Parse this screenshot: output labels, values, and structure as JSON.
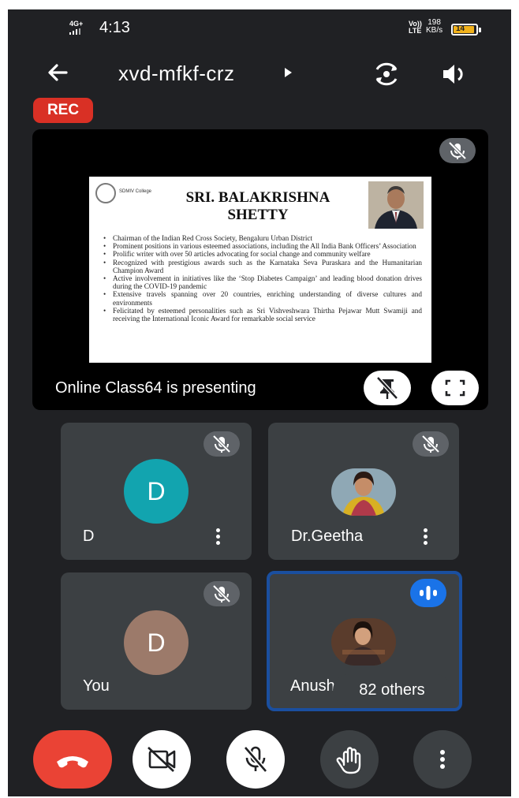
{
  "status_bar": {
    "network_left": "4G+",
    "time": "4:13",
    "network_right_1": "Vo))",
    "network_right_2": "LTE",
    "speed_value": "198",
    "speed_unit": "KB/s",
    "battery_level": "14"
  },
  "top_bar": {
    "meeting_code": "xvd-mfkf-crz"
  },
  "rec_label": "REC",
  "presentation": {
    "slide": {
      "logo_text": "SDMIV College",
      "title_line1": "SRI. BALAKRISHNA",
      "title_line2": "SHETTY",
      "bullets": [
        "Chairman of the Indian Red Cross Society, Bengaluru Urban District",
        "Prominent positions in various esteemed associations, including the All India Bank Officers’ Association",
        "Prolific writer with over 50 articles advocating for social change and community welfare",
        "Recognized with prestigious awards such as the Karnataka Seva Puraskara and the Humanitarian Champion Award",
        "Active involvement in initiatives like the ‘Stop Diabetes Campaign’ and leading blood donation drives during the COVID-19 pandemic",
        "Extensive travels spanning over 20 countries, enriching understanding of diverse cultures and environments",
        "Felicitated by esteemed personalities such as Sri Vishveshwara Thirtha Pejawar Mutt Swamiji and receiving the International Iconic Award for remarkable social service"
      ]
    },
    "presenting_text": "Online Class64 is presenting"
  },
  "participants": [
    {
      "name": "D",
      "avatar_letter": "D",
      "avatar_color": "#12a4af"
    },
    {
      "name": "Dr.Geetha"
    },
    {
      "name": "You",
      "avatar_letter": "D",
      "avatar_color": "#9c7a6a"
    },
    {
      "name": "Anusha"
    }
  ],
  "others_label": "82 others",
  "colors": {
    "background": "#202124",
    "tile": "#3c4043",
    "end_call": "#ea4335",
    "rec": "#d93025",
    "active_speaker": "#1a73e8"
  }
}
